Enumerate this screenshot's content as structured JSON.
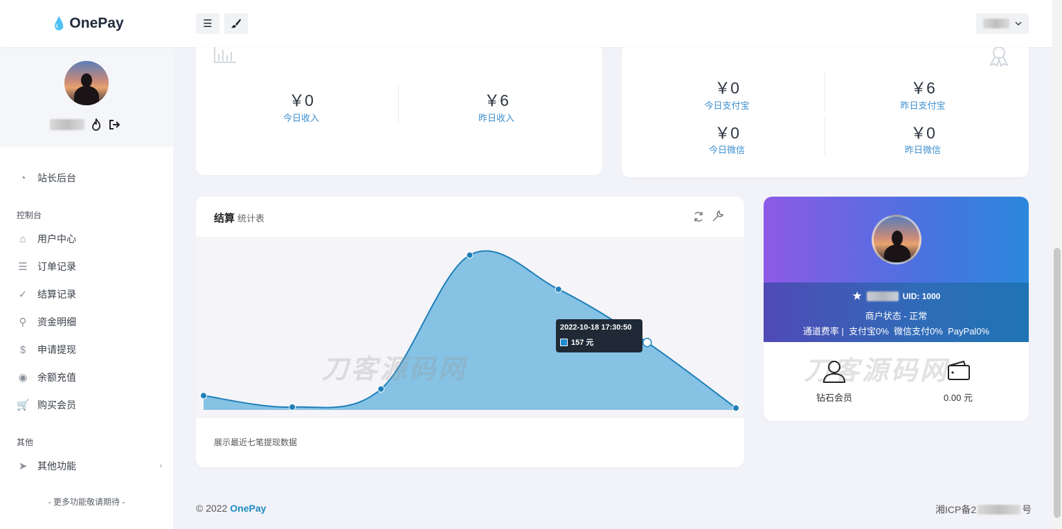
{
  "header": {
    "logo_text": "OnePay",
    "menu_icon": "menu-icon",
    "theme_icon": "brush-icon",
    "user_dropdown_icon": "chevron-down-icon"
  },
  "sidebar": {
    "groups": {
      "console": "控制台",
      "other": "其他"
    },
    "items": [
      {
        "label": "站长后台",
        "icon": "dashboard-icon"
      },
      {
        "label": "用户中心",
        "icon": "home-icon"
      },
      {
        "label": "订单记录",
        "icon": "list-icon"
      },
      {
        "label": "结算记录",
        "icon": "check-circle-icon"
      },
      {
        "label": "资金明细",
        "icon": "search-icon"
      },
      {
        "label": "申请提现",
        "icon": "dollar-icon"
      },
      {
        "label": "余额充值",
        "icon": "coin-icon"
      },
      {
        "label": "购买会员",
        "icon": "cart-icon"
      },
      {
        "label": "其他功能",
        "icon": "rocket-icon"
      }
    ],
    "footer": "- 更多功能敬请期待 -"
  },
  "income": {
    "today_value": "￥0",
    "today_label": "今日收入",
    "yesterday_value": "￥6",
    "yesterday_label": "昨日收入"
  },
  "channels": {
    "today_alipay_value": "￥0",
    "today_alipay_label": "今日支付宝",
    "yesterday_alipay_value": "￥6",
    "yesterday_alipay_label": "昨日支付宝",
    "today_wechat_value": "￥0",
    "today_wechat_label": "今日微信",
    "yesterday_wechat_value": "￥0",
    "yesterday_wechat_label": "昨日微信"
  },
  "settlement": {
    "title": "结算",
    "subtitle": "统计表",
    "footer_note": "展示最近七笔提现数据",
    "tooltip_date": "2022-10-18 17:30:50",
    "tooltip_value": "157 元",
    "watermark": "刀客源码网"
  },
  "chart_data": {
    "type": "area",
    "x": [
      1,
      2,
      3,
      4,
      5,
      6,
      7
    ],
    "values": [
      15,
      3,
      22,
      163,
      127,
      71,
      2
    ],
    "ylim": [
      0,
      175
    ],
    "grid": false,
    "legend": "none",
    "color": "#1e7fb8"
  },
  "profile": {
    "uid": "UID: 1000",
    "status": "商户状态 - 正常",
    "rates": "通道费率 |  支付宝0%  微信支付0%  PayPal0%",
    "member_label": "钻石会员",
    "balance": "0.00 元",
    "watermark": "刀客源码网"
  },
  "footer": {
    "copyright_prefix": "© 2022",
    "brand": "OnePay",
    "icp_prefix": "湘ICP备2",
    "icp_suffix": "号"
  }
}
